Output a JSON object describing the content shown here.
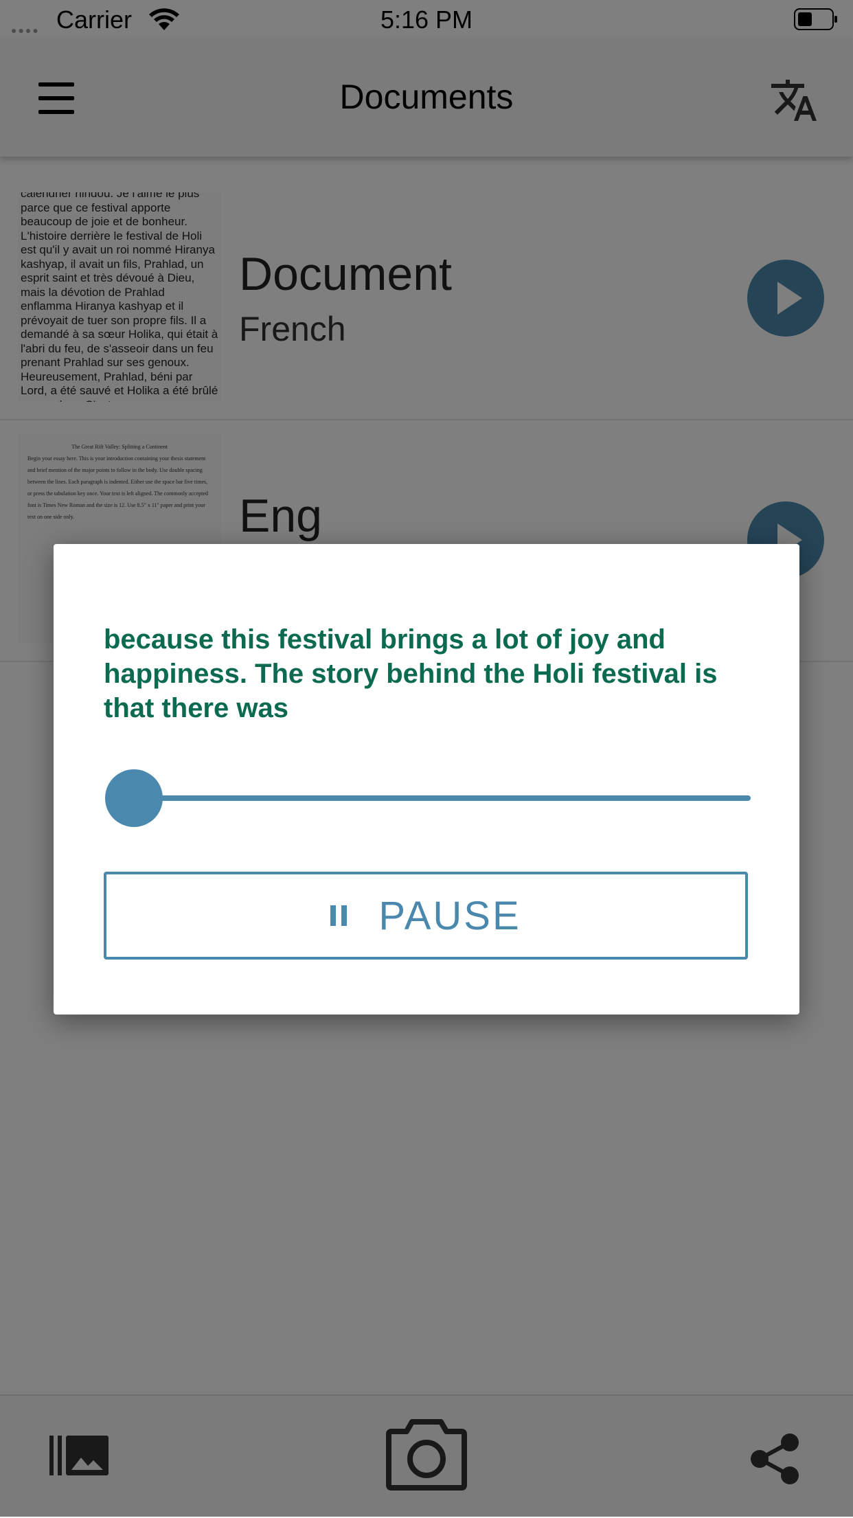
{
  "status_bar": {
    "carrier": "Carrier",
    "time": "5:16 PM"
  },
  "header": {
    "title": "Documents"
  },
  "documents": [
    {
      "title": "Document",
      "language": "French",
      "thumbnail_text": "calendrier hindou. Je l'aime le plus parce que ce festival apporte beaucoup de joie et de bonheur. L'histoire derrière le festival de Holi est qu'il y avait un roi nommé Hiranya kashyap, il avait un fils, Prahlad, un esprit saint et très dévoué à Dieu, mais la dévotion de Prahlad enflamma Hiranya kashyap et il prévoyait de tuer son propre fils. Il a demandé à sa sœur Holika, qui était à l'abri du feu, de s'asseoir dans un feu prenant Prahlad sur ses genoux. Heureusement, Prahlad, béni par Lord, a été sauvé et Holika a été brûlé en cendres. C'est"
    },
    {
      "title": "Eng",
      "language": "",
      "thumbnail_heading": "The Great Rift Valley: Splitting a Continent",
      "thumbnail_text": "Begin your essay here. This is your introduction containing your thesis statement and brief mention of the major points to follow in the body. Use double spacing between the lines. Each paragraph is indented. Either use the space bar five times, or press the tabulation key once. Your text is left aligned. The commonly accepted font is Times New Roman and the size is 12. Use 8.5\" x 11\" paper and print your text on one side only."
    }
  ],
  "dialog": {
    "reading_text": "because this festival brings a lot of joy and happiness. The story behind the Holi festival is that there was",
    "progress": 0.0,
    "pause_label": "PAUSE"
  },
  "colors": {
    "accent": "#4a89ad",
    "reading_text": "#0b6a4f"
  },
  "icons": [
    "menu-icon",
    "translate-icon",
    "play-icon",
    "gallery-icon",
    "camera-icon",
    "share-icon",
    "pause-icon"
  ]
}
